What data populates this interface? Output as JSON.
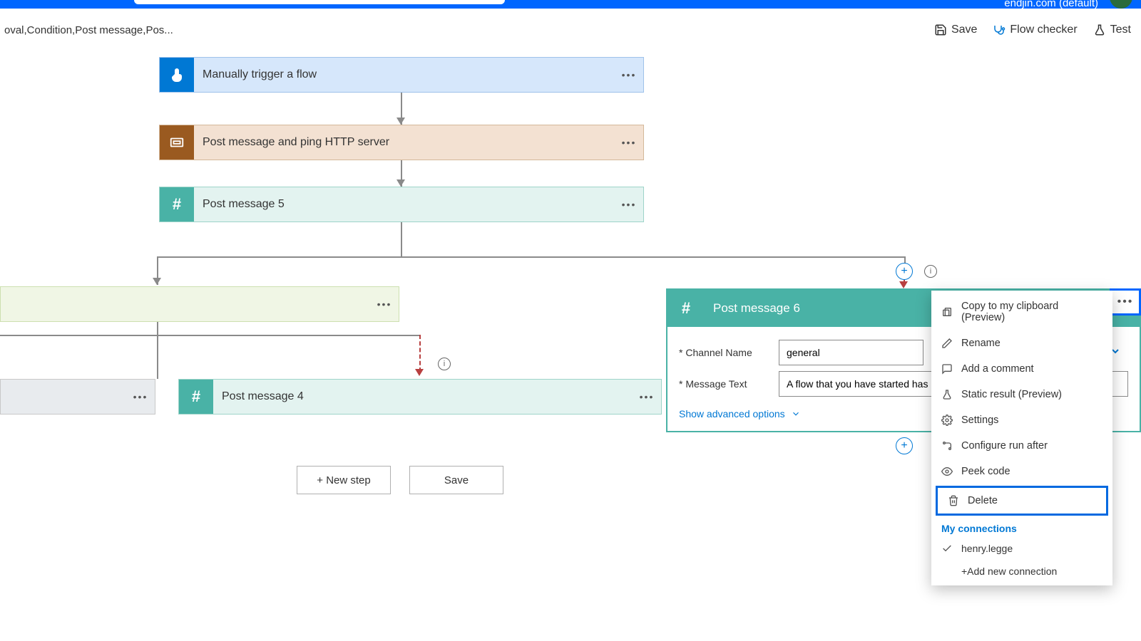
{
  "header": {
    "tenant": "endjin.com (default)"
  },
  "subheader": {
    "breadcrumb": "oval,Condition,Post message,Pos...",
    "save": "Save",
    "flow_checker": "Flow checker",
    "test": "Test"
  },
  "cards": {
    "trigger": "Manually trigger a flow",
    "http": "Post message and ping HTTP server",
    "pm5": "Post message 5",
    "pm4": "Post message 4",
    "pm6": "Post message 6"
  },
  "pm6_form": {
    "channel_label": "Channel Name",
    "channel_value": "general",
    "message_label": "Message Text",
    "message_value": "A flow that you have started has",
    "show_advanced": "Show advanced options"
  },
  "context_menu": {
    "copy": "Copy to my clipboard (Preview)",
    "rename": "Rename",
    "comment": "Add a comment",
    "static_result": "Static result (Preview)",
    "settings": "Settings",
    "run_after": "Configure run after",
    "peek": "Peek code",
    "delete": "Delete",
    "my_connections": "My connections",
    "conn1": "henry.legge",
    "add_conn": "+Add new connection"
  },
  "footer": {
    "new_step": "+ New step",
    "save": "Save"
  }
}
